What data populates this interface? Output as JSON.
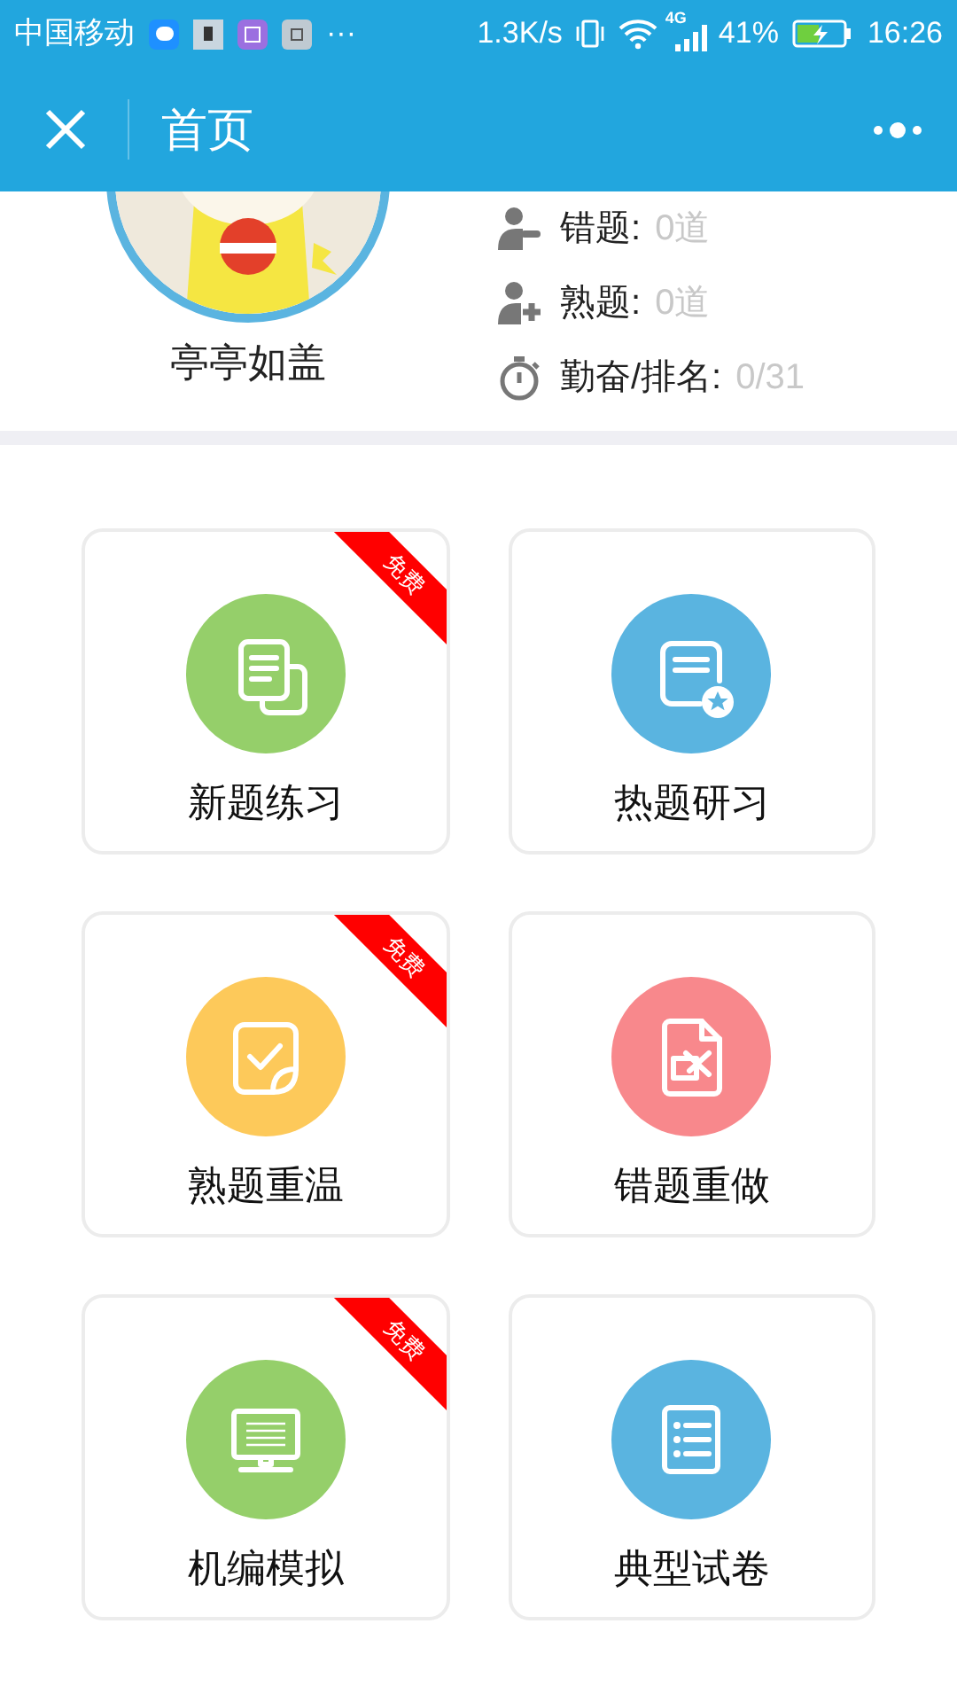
{
  "status_bar": {
    "carrier": "中国移动",
    "more": "···",
    "speed": "1.3K/s",
    "network": "4G",
    "battery": "41%",
    "time": "16:26"
  },
  "nav_bar": {
    "title": "首页"
  },
  "profile": {
    "name": "亭亭如盖",
    "stats": [
      {
        "label": "错题:",
        "value": "0道"
      },
      {
        "label": "熟题:",
        "value": "0道"
      },
      {
        "label": "勤奋/排名:",
        "value": "0/31"
      }
    ]
  },
  "cards": [
    {
      "label": "新题练习",
      "color": "#95cf6a",
      "badge": "免费"
    },
    {
      "label": "热题研习",
      "color": "#5ab4e0"
    },
    {
      "label": "熟题重温",
      "color": "#fdc95a",
      "badge": "免费"
    },
    {
      "label": "错题重做",
      "color": "#f8888c"
    },
    {
      "label": "机编模拟",
      "color": "#95cf6a",
      "badge": "免费"
    },
    {
      "label": "典型试卷",
      "color": "#5ab4e0"
    }
  ]
}
